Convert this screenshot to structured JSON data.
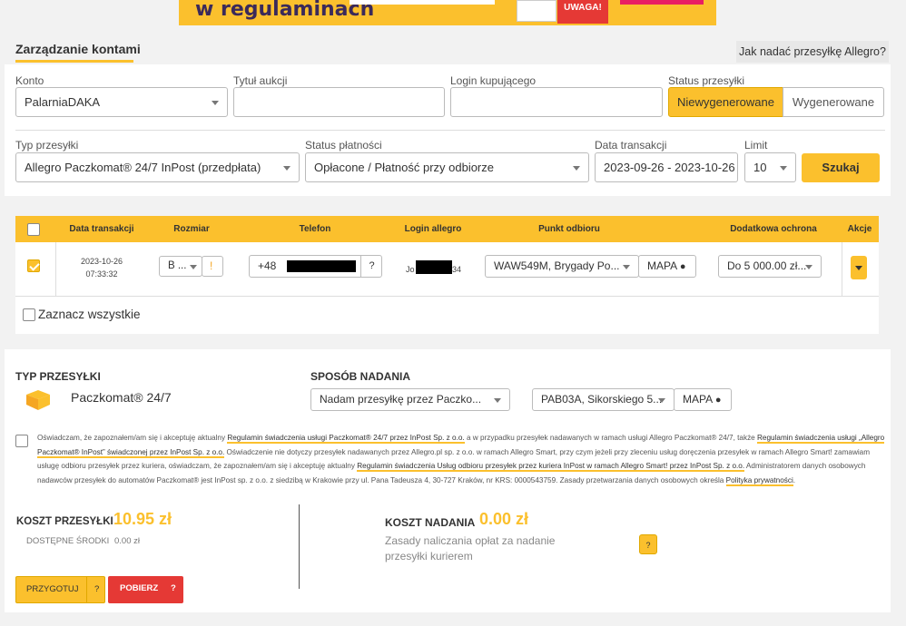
{
  "banner": {
    "text": "w regulaminach",
    "badge": "UWAGA!"
  },
  "header": {
    "title": "Zarządzanie kontami",
    "help_link": "Jak nadać przesyłkę Allegro?"
  },
  "filters": {
    "konto": {
      "label": "Konto",
      "value": "PalarniaDAKA"
    },
    "tytul": {
      "label": "Tytuł aukcji",
      "value": ""
    },
    "login": {
      "label": "Login kupującego",
      "value": ""
    },
    "status_przesylki": {
      "label": "Status przesyłki",
      "options": [
        "Niewygenerowane",
        "Wygenerowane"
      ],
      "selected": "Niewygenerowane"
    },
    "typ": {
      "label": "Typ przesyłki",
      "value": "Allegro Paczkomat® 24/7 InPost (przedpłata)"
    },
    "status_platnosci": {
      "label": "Status płatności",
      "value": "Opłacone / Płatność przy odbiorze"
    },
    "data": {
      "label": "Data transakcji",
      "value": "2023-09-26 - 2023-10-26"
    },
    "limit": {
      "label": "Limit",
      "value": "10"
    },
    "search_button": "Szukaj"
  },
  "table": {
    "columns": [
      "Data transakcji",
      "Rozmiar",
      "Telefon",
      "Login allegro",
      "Punkt odbioru",
      "Dodatkowa ochrona",
      "Akcje"
    ],
    "row": {
      "date": "2023-10-26",
      "time": "07:33:32",
      "size": "B ...",
      "size_warn": "!",
      "phone_prefix": "+48",
      "phone_help": "?",
      "login_prefix": "Jo",
      "login_suffix": "34",
      "point": "WAW549M, Brygady Po...",
      "map": "MAPA",
      "protection": "Do 5 000.00 zł..."
    },
    "select_all": "Zaznacz wszystkie"
  },
  "shipment": {
    "type_heading": "TYP PRZESYŁKI",
    "type_value": "Paczkomat® 24/7",
    "method_heading": "SPOSÓB NADANIA",
    "method_value": "Nadam przesyłkę przez Paczko...",
    "point_value": "PAB03A, Sikorskiego 5...",
    "map": "MAPA"
  },
  "legal": {
    "t1": "Oświadczam, że zapoznałem/am się i akceptuję aktualny ",
    "l1": "Regulamin świadczenia usługi Paczkomat® 24/7 przez InPost Sp. z o.o.",
    "t2": " a w przypadku przesyłek nadawanych w ramach usługi Allegro Paczkomat® 24/7, także ",
    "l2": "Regulamin świadczenia usługi „Allegro Paczkomat® InPost” świadczonej przez InPost Sp. z o.o.",
    "t3": " Oświadczenie nie dotyczy przesyłek nadawanych przez Allegro.pl sp. z o.o. w ramach Allegro Smart, przy czym jeżeli przy zleceniu usług doręczenia przesyłek w ramach Allegro Smart! zamawiam usługę odbioru przesyłek przez kuriera, oświadczam, że zapoznałem/am się i akceptuję aktualny ",
    "l3": "Regulamin świadczenia Usług odbioru przesyłek przez kuriera InPost w ramach Allegro Smart! przez InPost Sp. z o.o.",
    "t4": " Administratorem danych osobowych nadawców przesyłek do automatów Paczkomat® jest InPost sp. z o.o. z siedzibą w Krakowie przy ul. Pana Tadeusza 4, 30-727 Kraków, nr KRS: 0000543759. Zasady przetwarzania danych osobowych określa ",
    "l4": "Polityka prywatności",
    "t5": "."
  },
  "costs": {
    "koszt_label": "KOSZT PRZESYŁKI",
    "koszt_value": "10.95 zł",
    "srodki_label": "DOSTĘPNE ŚRODKI",
    "srodki_value": "0.00 zł",
    "nadania_label": "KOSZT NADANIA",
    "nadania_value": "0.00 zł",
    "note": "Zasady naliczania opłat za nadanie przesyłki kurierem",
    "help": "?"
  },
  "actions": {
    "prepare": "PRZYGOTUJ",
    "prepare_help": "?",
    "download": "POBIERZ",
    "download_help": "?"
  }
}
